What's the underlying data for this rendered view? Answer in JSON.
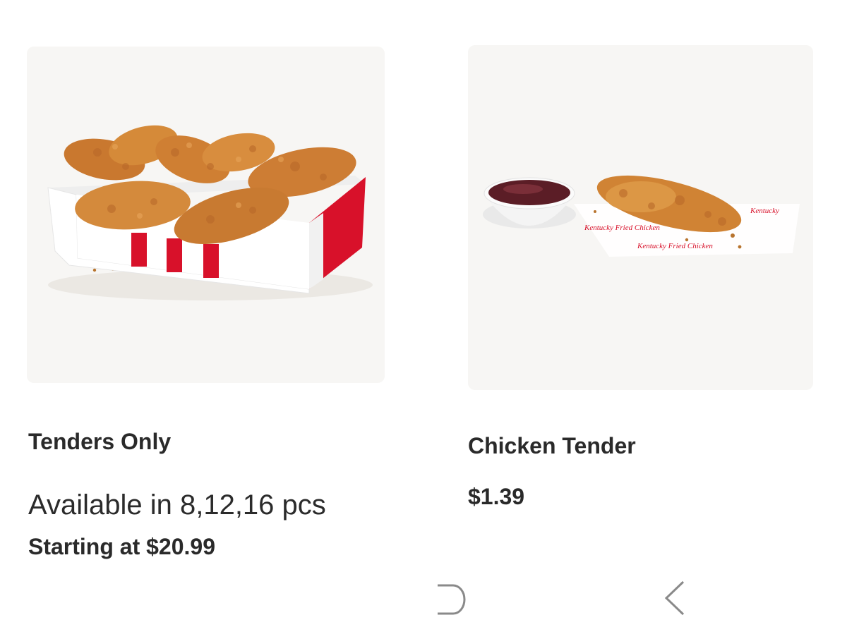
{
  "products": [
    {
      "title": "Tenders Only",
      "availability": "Available in 8,12,16 pcs",
      "starting_price": "Starting at $20.99",
      "image_icon": "chicken-tenders-box-image"
    },
    {
      "title": "Chicken Tender",
      "price": "$1.39",
      "image_icon": "single-chicken-tender-with-sauce-image"
    }
  ],
  "navigation": {
    "home_icon": "home-icon",
    "back_icon": "back-chevron-icon"
  },
  "colors": {
    "card_background": "#f7f6f4",
    "brand_red": "#d8112a",
    "text": "#2a2a2a"
  }
}
